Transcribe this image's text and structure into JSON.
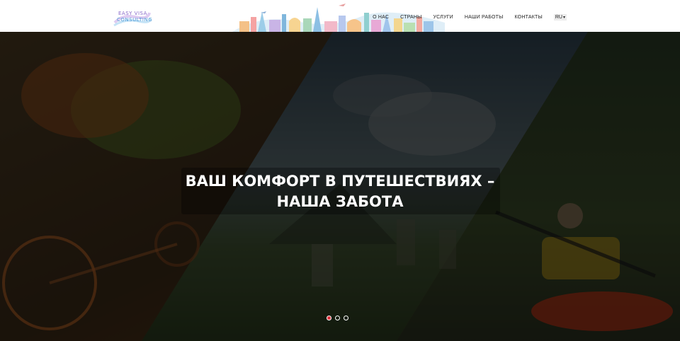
{
  "header": {
    "logo": {
      "line1": "EASY VISA",
      "line2": "CONSULTING"
    },
    "nav": [
      {
        "label": "О НАС"
      },
      {
        "label": "СТРАНЫ"
      },
      {
        "label": "УСЛУГИ"
      },
      {
        "label": "НАШИ РАБОТЫ"
      },
      {
        "label": "КОНТАКТЫ"
      }
    ],
    "language": {
      "selected": "RU"
    }
  },
  "hero": {
    "title_line1": "ВАШ КОМФОРТ В ПУТЕШЕСТВИЯХ –",
    "title_line2": "НАША ЗАБОТА",
    "slides": [
      {
        "active": true
      },
      {
        "active": false
      },
      {
        "active": false
      }
    ]
  },
  "colors": {
    "accent_dot": "#e0323c",
    "header_bg": "#ffffff",
    "overlay": "#000000"
  }
}
